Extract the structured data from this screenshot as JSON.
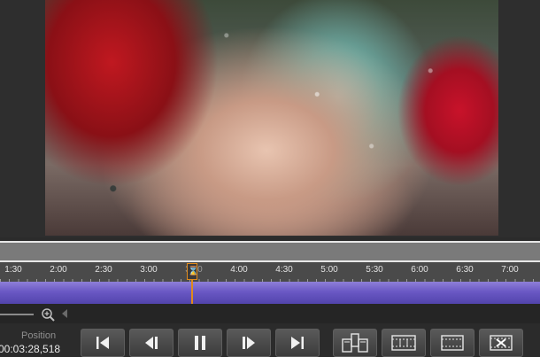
{
  "timeline": {
    "tick_labels": [
      "1:30",
      "2:00",
      "2:30",
      "3:00",
      "3:30",
      "4:00",
      "4:30",
      "5:00",
      "5:30",
      "6:00",
      "6:30",
      "7:00"
    ],
    "playhead_time": "3:30"
  },
  "position": {
    "label": "Position",
    "value": "00:03:28,518"
  },
  "controls": {
    "buttons": [
      {
        "name": "go-to-start-button",
        "icon": "skip-start-icon"
      },
      {
        "name": "previous-frame-button",
        "icon": "step-back-icon"
      },
      {
        "name": "pause-button",
        "icon": "pause-icon"
      },
      {
        "name": "next-frame-button",
        "icon": "step-forward-icon"
      },
      {
        "name": "go-to-end-button",
        "icon": "skip-end-icon"
      },
      {
        "name": "split-button",
        "icon": "split-clip-icon"
      },
      {
        "name": "film-strip-button",
        "icon": "film-strip-icon"
      },
      {
        "name": "frame-button",
        "icon": "frame-icon"
      },
      {
        "name": "delete-segment-button",
        "icon": "delete-segment-icon"
      }
    ]
  },
  "colors": {
    "accent": "#e08a1c",
    "track": "#6a58c4"
  }
}
